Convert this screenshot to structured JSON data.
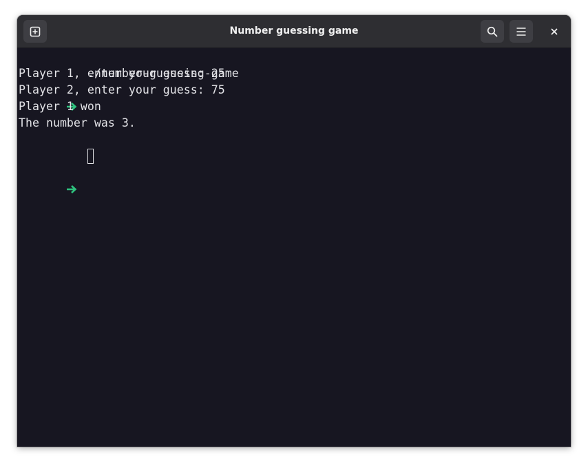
{
  "window": {
    "title": "Number guessing game"
  },
  "header": {
    "new_tab_icon": "tab-new-icon",
    "search_icon": "search-icon",
    "menu_icon": "hamburger-menu-icon",
    "close_icon": "close-icon"
  },
  "terminal": {
    "command": "./number-guessing-game",
    "output": [
      "Player 1, enter your guess: 25",
      "Player 2, enter your guess: 75",
      "Player 1 won",
      "The number was 3."
    ],
    "prompt_color": "#2ec27e",
    "background": "#171621",
    "foreground": "#e2e2e6"
  }
}
